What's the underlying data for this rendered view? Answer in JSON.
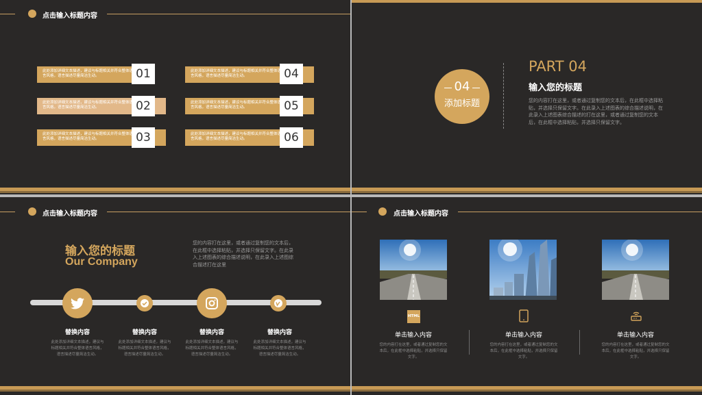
{
  "slide1": {
    "header": "点击输入标题内容",
    "items": [
      {
        "num": "01",
        "text": "此处添加详细文本描述，建议与标题相关并符合整体语言风格，语言描述尽量简洁生动。"
      },
      {
        "num": "02",
        "text": "此处添加详细文本描述，建议与标题相关并符合整体语言风格，语言描述尽量简洁生动。"
      },
      {
        "num": "03",
        "text": "此处添加详细文本描述，建议与标题相关并符合整体语言风格，语言描述尽量简洁生动。"
      },
      {
        "num": "04",
        "text": "此处添加详细文本描述，建议与标题相关并符合整体语言风格，语言描述尽量简洁生动。"
      },
      {
        "num": "05",
        "text": "此处添加详细文本描述，建议与标题相关并符合整体语言风格，语言描述尽量简洁生动。"
      },
      {
        "num": "06",
        "text": "此处添加详细文本描述，建议与标题相关并符合整体语言风格，语言描述尽量简洁生动。"
      }
    ]
  },
  "slide2": {
    "circle_num": "04",
    "circle_label": "添加标题",
    "part": "PART 04",
    "title": "输入您的标题",
    "body": "您的内容打在这里，或者通过复制您的文本后，在此框中选择粘贴，并选择只保留文字。在此录入上述图表的综合描述说明，在此录入上述图表综合描述的打在这里，或者通过复制您的文本后，在此框中选择粘贴，并选择只保留文字。"
  },
  "slide3": {
    "header": "点击输入标题内容",
    "title_cn": "输入您的标题",
    "title_en": "Our Company",
    "body": "您的内容打在这里，或者通过复制您的文本后，在此框中选择粘贴，并选择只保留文字。在此录入上述图表的综合描述说明，在此录入上述图综合描述打在这里",
    "nodes": [
      {
        "icon": "twitter-icon",
        "title": "替换内容",
        "desc": "此处添加详细文本描述，建议与标题相关并符合整体语言风格，语言描述尽量简洁生动。"
      },
      {
        "icon": "check-icon",
        "title": "替换内容",
        "desc": "此处添加详细文本描述，建议与标题相关并符合整体语言风格，语言描述尽量简洁生动。"
      },
      {
        "icon": "instagram-icon",
        "title": "替换内容",
        "desc": "此处添加详细文本描述，建议与标题相关并符合整体语言风格，语言描述尽量简洁生动。"
      },
      {
        "icon": "vimeo-icon",
        "title": "替换内容",
        "desc": "此处添加详细文本描述，建议与标题相关并符合整体语言风格，语言描述尽量简洁生动。"
      }
    ]
  },
  "slide4": {
    "header": "点击输入标题内容",
    "columns": [
      {
        "icon": "html-icon",
        "icon_text": "HTML",
        "title": "单击输入内容",
        "desc": "您的内容打在这里，或者通过复制您的文本后，在此框中选择粘贴，并选择只保留文字。"
      },
      {
        "icon": "tablet-icon",
        "title": "单击输入内容",
        "desc": "您的内容打在这里，或者通过复制您的文本后，在此框中选择粘贴，并选择只保留文字。"
      },
      {
        "icon": "router-icon",
        "title": "单击输入内容",
        "desc": "您的内容打在这里，或者通过复制您的文本后，在此框中选择粘贴，并选择只保留文字。"
      }
    ]
  },
  "colors": {
    "accent": "#d4a65d",
    "background": "#2a2827"
  }
}
